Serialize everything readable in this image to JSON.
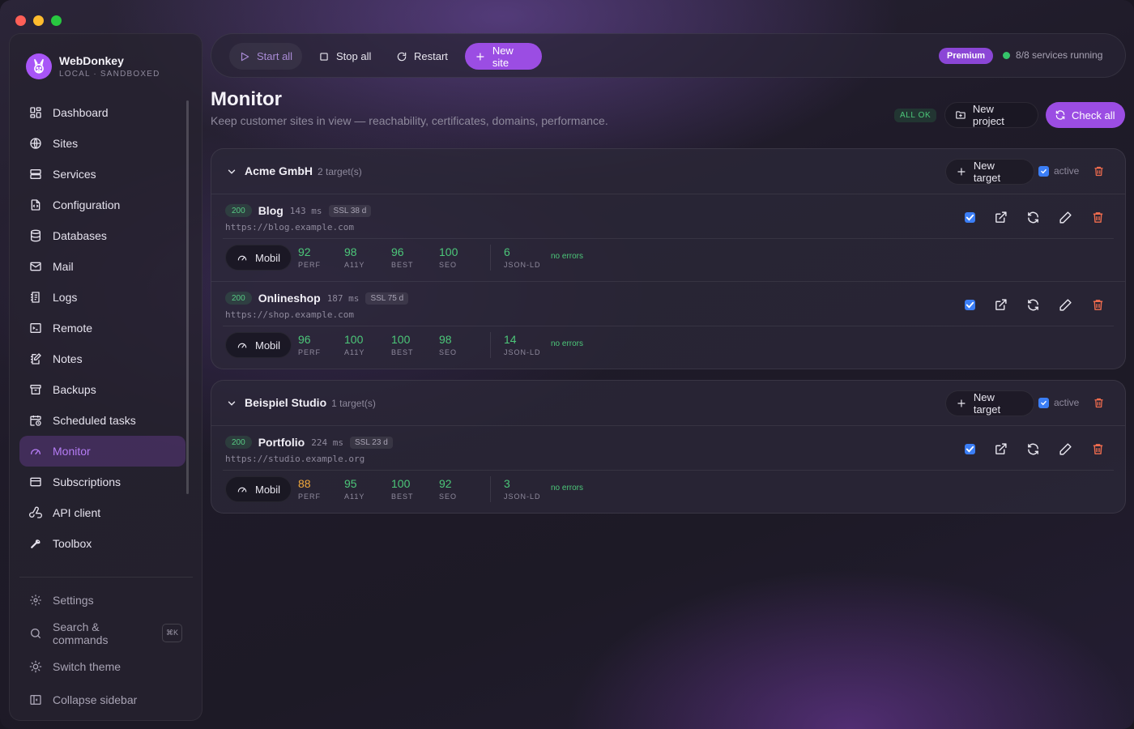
{
  "app": {
    "name": "WebDonkey",
    "subtitle": "LOCAL · SANDBOXED"
  },
  "sidebar": {
    "items": [
      {
        "label": "Dashboard",
        "icon": "dashboard-icon"
      },
      {
        "label": "Sites",
        "icon": "globe-icon"
      },
      {
        "label": "Services",
        "icon": "server-icon"
      },
      {
        "label": "Configuration",
        "icon": "config-file-icon"
      },
      {
        "label": "Databases",
        "icon": "database-icon"
      },
      {
        "label": "Mail",
        "icon": "mail-icon"
      },
      {
        "label": "Logs",
        "icon": "logs-icon"
      },
      {
        "label": "Remote",
        "icon": "terminal-icon"
      },
      {
        "label": "Notes",
        "icon": "notes-icon"
      },
      {
        "label": "Backups",
        "icon": "archive-icon"
      },
      {
        "label": "Scheduled tasks",
        "icon": "calendar-clock-icon"
      },
      {
        "label": "Monitor",
        "icon": "gauge-icon",
        "active": true
      },
      {
        "label": "Subscriptions",
        "icon": "credit-card-icon"
      },
      {
        "label": "API client",
        "icon": "webhook-icon"
      },
      {
        "label": "Toolbox",
        "icon": "wrench-icon"
      }
    ],
    "bottom": [
      {
        "label": "Settings",
        "icon": "gear-icon"
      },
      {
        "label": "Search & commands",
        "icon": "search-icon",
        "shortcut": "⌘K"
      },
      {
        "label": "Switch theme",
        "icon": "sun-icon"
      },
      {
        "label": "Collapse sidebar",
        "icon": "sidebar-collapse-icon"
      }
    ]
  },
  "toolbar": {
    "start_all": "Start all",
    "stop_all": "Stop all",
    "restart": "Restart",
    "new_site": "New site",
    "plan_badge": "Premium",
    "services_status": "8/8 services running"
  },
  "page": {
    "title": "Monitor",
    "subtitle": "Keep customer sites in view — reachability, certificates, domains, performance.",
    "status_badge": "ALL OK",
    "new_project": "New project",
    "check_all": "Check all"
  },
  "labels": {
    "new_target": "New target",
    "active": "active",
    "device": "Mobil",
    "perf": "PERF",
    "a11y": "A11Y",
    "best": "BEST",
    "seo": "SEO",
    "jsonld": "JSON-LD",
    "no_errors": "no errors"
  },
  "groups": [
    {
      "name": "Acme GmbH",
      "count": "2 target(s)",
      "active": true,
      "targets": [
        {
          "status": "200",
          "name": "Blog",
          "ms": "143 ms",
          "ssl": "SSL 38 d",
          "url": "https://blog.example.com",
          "perf": "92",
          "a11y": "98",
          "best": "96",
          "seo": "100",
          "jsonld": "6"
        },
        {
          "status": "200",
          "name": "Onlineshop",
          "ms": "187 ms",
          "ssl": "SSL 75 d",
          "url": "https://shop.example.com",
          "perf": "96",
          "a11y": "100",
          "best": "100",
          "seo": "98",
          "jsonld": "14"
        }
      ]
    },
    {
      "name": "Beispiel Studio",
      "count": "1 target(s)",
      "active": true,
      "targets": [
        {
          "status": "200",
          "name": "Portfolio",
          "ms": "224 ms",
          "ssl": "SSL 23 d",
          "url": "https://studio.example.org",
          "perf": "88",
          "a11y": "95",
          "best": "100",
          "seo": "92",
          "jsonld": "3"
        }
      ]
    }
  ],
  "colors": {
    "accent": "#9b4de3",
    "ok": "#4cc779",
    "warn": "#f2a93b",
    "danger": "#f06c4e",
    "check": "#3b7ef6"
  }
}
